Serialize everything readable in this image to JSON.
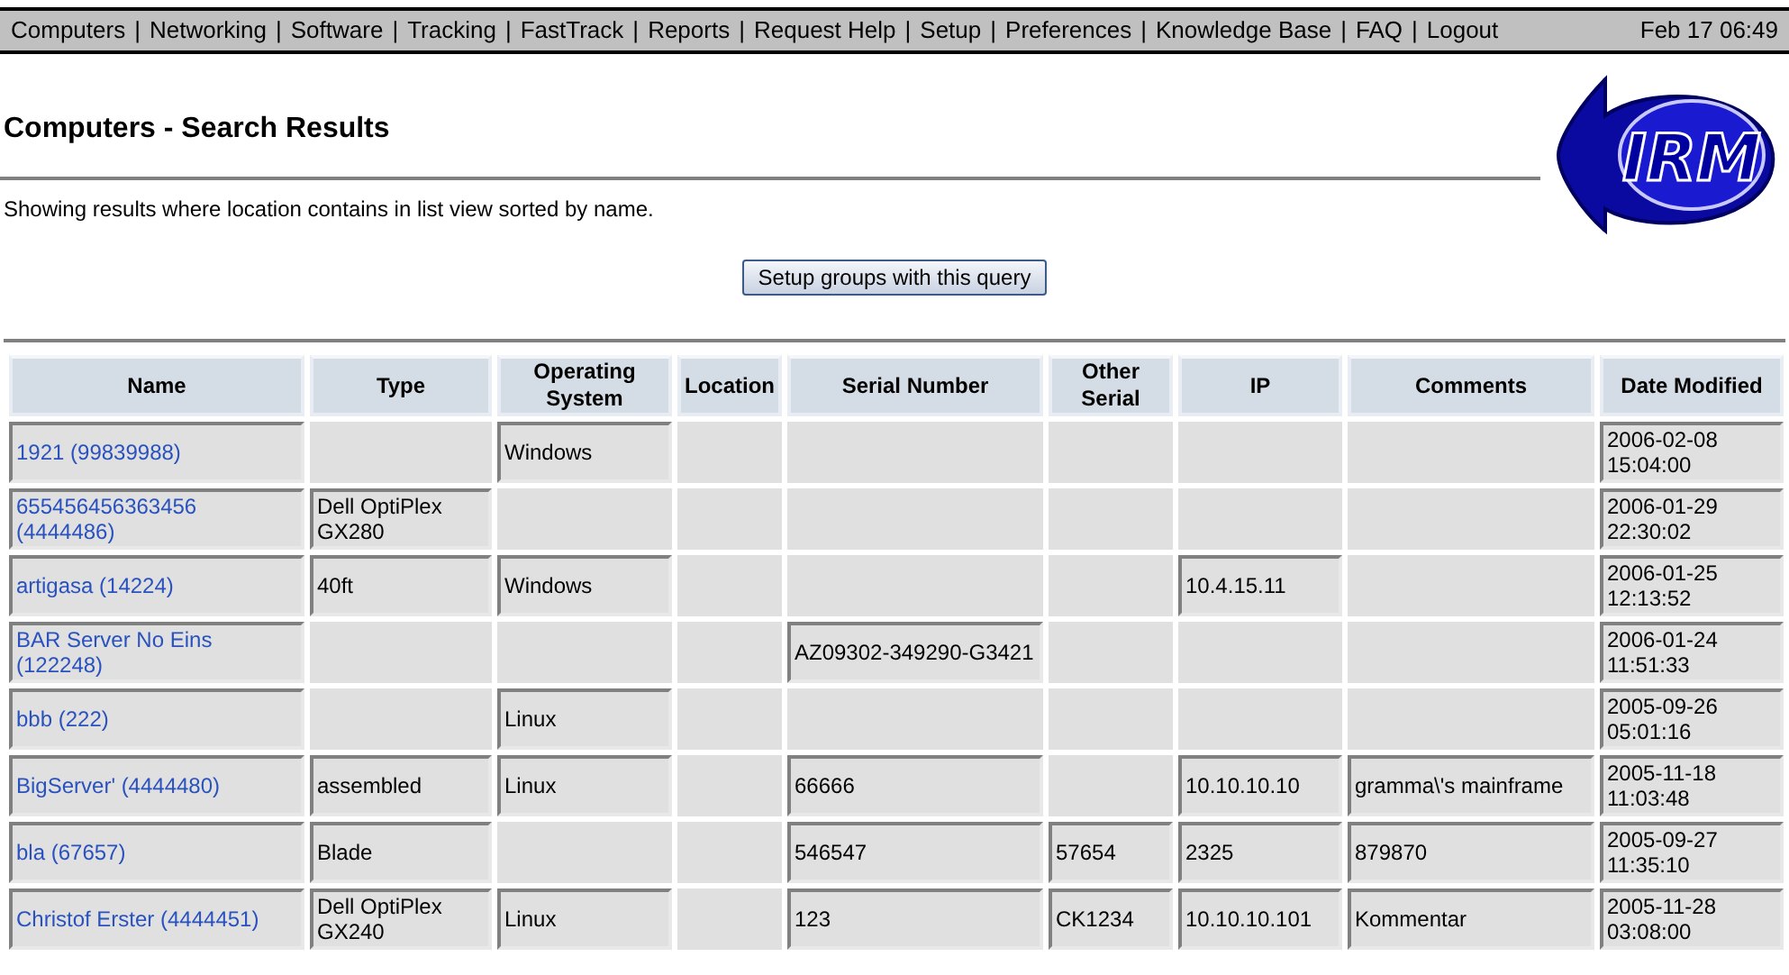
{
  "nav": {
    "separator": "|",
    "items": [
      "Computers",
      "Networking",
      "Software",
      "Tracking",
      "FastTrack",
      "Reports",
      "Request Help",
      "Setup",
      "Preferences",
      "Knowledge Base",
      "FAQ",
      "Logout"
    ],
    "clock": "Feb 17 06:49"
  },
  "title": "Computers - Search Results",
  "logo": {
    "text": "IRM"
  },
  "summary": "Showing results where location contains in list view sorted by name.",
  "query_button": "Setup groups with this query",
  "table": {
    "columns": [
      "Name",
      "Type",
      "Operating System",
      "Location",
      "Serial Number",
      "Other Serial",
      "IP",
      "Comments",
      "Date Modified"
    ],
    "rows": [
      [
        "1921 (99839988)",
        "",
        "Windows",
        "",
        "",
        "",
        "",
        "",
        "2006-02-08 15:04:00"
      ],
      [
        "655456456363456 (4444486)",
        "Dell OptiPlex GX280",
        "",
        "",
        "",
        "",
        "",
        "",
        "2006-01-29 22:30:02"
      ],
      [
        "artigasa (14224)",
        "40ft",
        "Windows",
        "",
        "",
        "",
        "10.4.15.11",
        "",
        "2006-01-25 12:13:52"
      ],
      [
        "BAR Server No Eins (122248)",
        "",
        "",
        "",
        "AZ09302-349290-G3421",
        "",
        "",
        "",
        "2006-01-24 11:51:33"
      ],
      [
        "bbb (222)",
        "",
        "Linux",
        "",
        "",
        "",
        "",
        "",
        "2005-09-26 05:01:16"
      ],
      [
        "BigServer' (4444480)",
        "assembled",
        "Linux",
        "",
        "66666",
        "",
        "10.10.10.10",
        "gramma\\'s mainframe",
        "2005-11-18 11:03:48"
      ],
      [
        "bla (67657)",
        "Blade",
        "",
        "",
        "546547",
        "57654",
        "2325",
        "879870",
        "2005-09-27 11:35:10"
      ],
      [
        "Christof Erster (4444451)",
        "Dell OptiPlex GX240",
        "Linux",
        "",
        "123",
        "CK1234",
        "10.10.10.101",
        "Kommentar",
        "2005-11-28 03:08:00"
      ]
    ]
  }
}
